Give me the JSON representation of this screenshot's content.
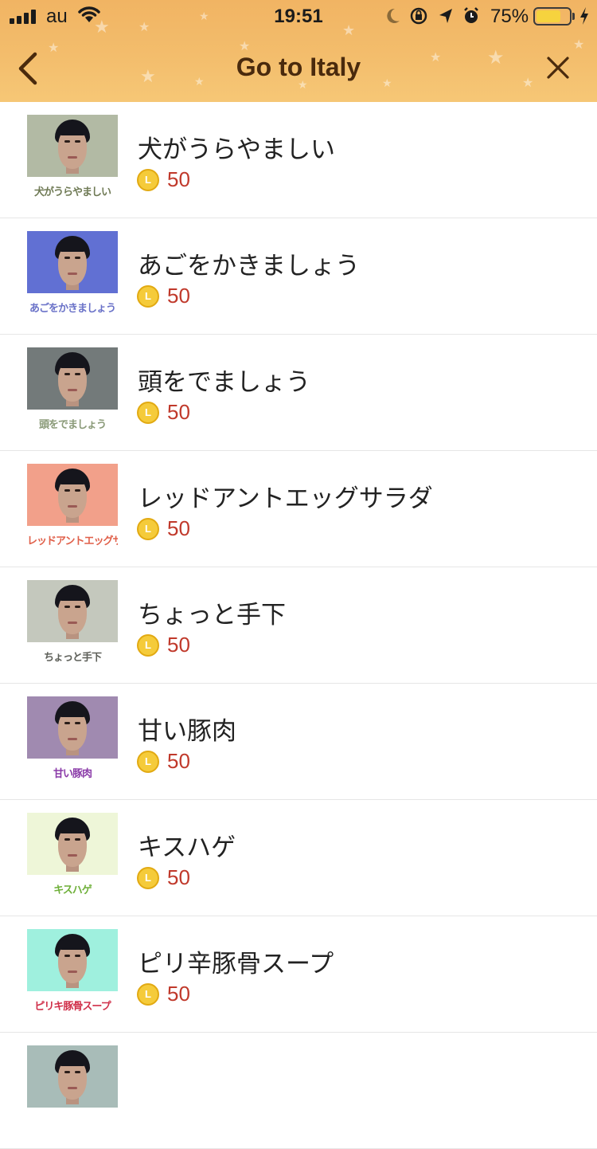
{
  "status_bar": {
    "carrier": "au",
    "time": "19:51",
    "battery_percent": "75%",
    "battery_level": 0.75
  },
  "header": {
    "title": "Go to Italy",
    "back_icon": "chevron-left-icon",
    "close_icon": "close-icon"
  },
  "coin_symbol": "L",
  "items": [
    {
      "name": "犬がうらやましい",
      "caption": "犬がうらやましい",
      "price": "50",
      "bg": "#b2baa4",
      "caption_color": "#6f7a55"
    },
    {
      "name": "あごをかきましょう",
      "caption": "あごをかきましょう",
      "price": "50",
      "bg": "#6170d3",
      "caption_color": "#6a72c8"
    },
    {
      "name": "頭をでましょう",
      "caption": "頭をでましょう",
      "price": "50",
      "bg": "#737a7a",
      "caption_color": "#8a9a78"
    },
    {
      "name": "レッドアントエッグサラダ",
      "caption": "レッドアントエッグサラダ",
      "price": "50",
      "bg": "#f2a08a",
      "caption_color": "#e0604a"
    },
    {
      "name": "ちょっと手下",
      "caption": "ちょっと手下",
      "price": "50",
      "bg": "#c4c8bd",
      "caption_color": "#5e605a"
    },
    {
      "name": "甘い豚肉",
      "caption": "甘い豚肉",
      "price": "50",
      "bg": "#a08ab0",
      "caption_color": "#8a3aa8"
    },
    {
      "name": "キスハゲ",
      "caption": "キスハゲ",
      "price": "50",
      "bg": "#eef6d8",
      "caption_color": "#6fb03a"
    },
    {
      "name": "ピリ辛豚骨スープ",
      "caption": "ピリキ豚骨スープ",
      "price": "50",
      "bg": "#9ff0de",
      "caption_color": "#d0304a"
    },
    {
      "name": "",
      "caption": "",
      "price": "",
      "bg": "#a8bcb8",
      "caption_color": "#555555"
    }
  ]
}
